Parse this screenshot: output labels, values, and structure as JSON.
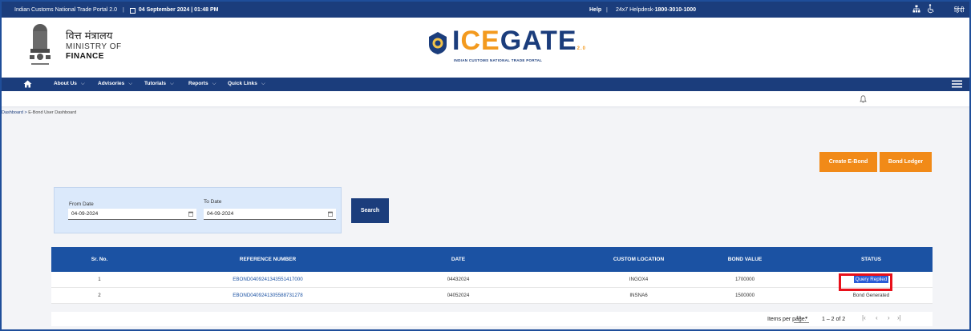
{
  "topbar": {
    "portal": "Indian Customs National Trade Portal 2.0",
    "datetime": "04 September 2024 | 01:48 PM",
    "help": "Help",
    "helpdesk_label": "24x7 Helpdesk-",
    "helpdesk_number": "1800-3010-1000",
    "language": "हिंदी"
  },
  "header": {
    "ministry_hindi": "वित्त मंत्रालय",
    "ministry_en_line1": "MINISTRY OF",
    "ministry_en_line2": "FINANCE",
    "logo_pre": "I",
    "logo_ce": "CE",
    "logo_post": "GATE",
    "logo_version": "2.0",
    "logo_subtitle": "INDIAN CUSTOMS NATIONAL TRADE PORTAL"
  },
  "nav": {
    "items": [
      "About Us",
      "Advisories",
      "Tutorials",
      "Reports",
      "Quick Links"
    ]
  },
  "breadcrumb": {
    "parent": "Dashboard",
    "separator": " > ",
    "current": "E-Bond User Dashboard"
  },
  "actions": {
    "create": "Create E-Bond",
    "ledger": "Bond Ledger"
  },
  "filter": {
    "from_label": "From Date",
    "from_value": "04-09-2024",
    "to_label": "To Date",
    "to_value": "04-09-2024",
    "search": "Search"
  },
  "table": {
    "headers": [
      "Sr. No.",
      "REFERENCE NUMBER",
      "DATE",
      "CUSTOM LOCATION",
      "BOND VALUE",
      "STATUS"
    ],
    "rows": [
      [
        "1",
        "EBOND04092413435514170​00",
        "04432024",
        "INGOX4",
        "1700000",
        "Query Replied"
      ],
      [
        "2",
        "EBOND0409241305588731278",
        "04052024",
        "INSNA6",
        "1500000",
        "Bond Generated"
      ]
    ]
  },
  "pager": {
    "items_per_page_label": "Items per page:",
    "items_per_page": "10",
    "range": "1 – 2 of 2"
  },
  "colors": {
    "brand_blue": "#1b3d7c",
    "header_blue": "#1b52a3",
    "accent_orange": "#f18a18",
    "highlight_red": "#e8101a"
  }
}
